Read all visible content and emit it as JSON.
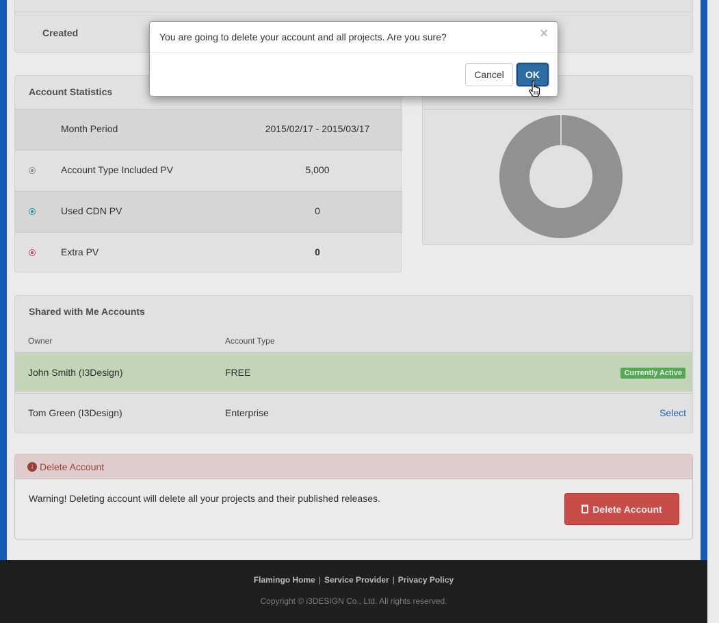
{
  "created": {
    "label": "Created"
  },
  "stats": {
    "title": "Account Statistics",
    "rows": [
      {
        "label": "Month Period",
        "value": "2015/02/17 - 2015/03/17"
      },
      {
        "label": "Account Type Included PV",
        "value": "5,000",
        "dot_color": "#999999"
      },
      {
        "label": "Used CDN PV",
        "value": "0",
        "dot_color": "#2aa5a0"
      },
      {
        "label": "Extra PV",
        "value": "0",
        "dot_color": "#d9534f"
      }
    ]
  },
  "donut": {
    "color": "#9e9e9e",
    "value_share": 1.0
  },
  "shared": {
    "title": "Shared with Me Accounts",
    "columns": [
      "Owner",
      "Account Type"
    ],
    "rows": [
      {
        "owner": "John Smith (I3Design)",
        "type": "FREE",
        "status": "Currently Active"
      },
      {
        "owner": "Tom Green (I3Design)",
        "type": "Enterprise",
        "action": "Select"
      }
    ]
  },
  "delete": {
    "heading": "Delete Account",
    "warning": "Warning! Deleting account will delete all your projects and their published releases.",
    "button": "Delete Account"
  },
  "footer": {
    "links": [
      "Flamingo Home",
      "Service Provider",
      "Privacy Policy"
    ],
    "copyright": "Copyright © i3DESIGN Co., Ltd. All rights reserved."
  },
  "modal": {
    "message": "You are going to delete your account and all projects. Are you sure?",
    "close": "×",
    "cancel": "Cancel",
    "ok": "OK"
  }
}
